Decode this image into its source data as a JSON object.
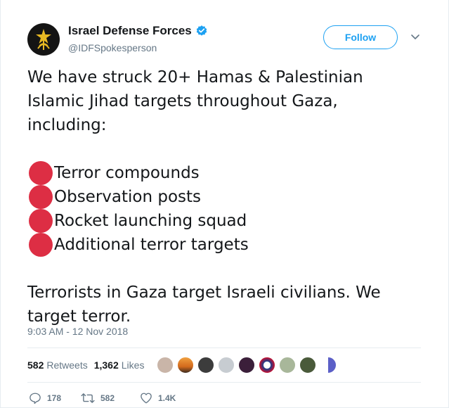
{
  "author": {
    "name": "Israel Defense Forces",
    "handle": "@IDFSpokesperson",
    "avatar_icon": "idf-emblem-icon",
    "verified_icon": "verified-badge-icon"
  },
  "follow_label": "Follow",
  "tweet": {
    "intro_line1": "We have struck 20+ Hamas & Palestinian",
    "intro_line2": "Islamic Jihad targets throughout Gaza,",
    "intro_line3": "including:",
    "bullets": [
      "Terror compounds",
      "Observation posts",
      "Rocket launching squad",
      "Additional terror targets"
    ],
    "outro_line1": "Terrorists in Gaza target Israeli civilians. We",
    "outro_line2": "target terror."
  },
  "timestamp": "9:03 AM - 12 Nov 2018",
  "stats": {
    "retweets_count": "582",
    "retweets_label": "Retweets",
    "likes_count": "1,362",
    "likes_label": "Likes"
  },
  "actions": {
    "replies": "178",
    "retweets": "582",
    "likes": "1.4K"
  },
  "colors": {
    "accent": "#1da1f2",
    "bullet": "#dd2e44",
    "muted": "#657786"
  }
}
